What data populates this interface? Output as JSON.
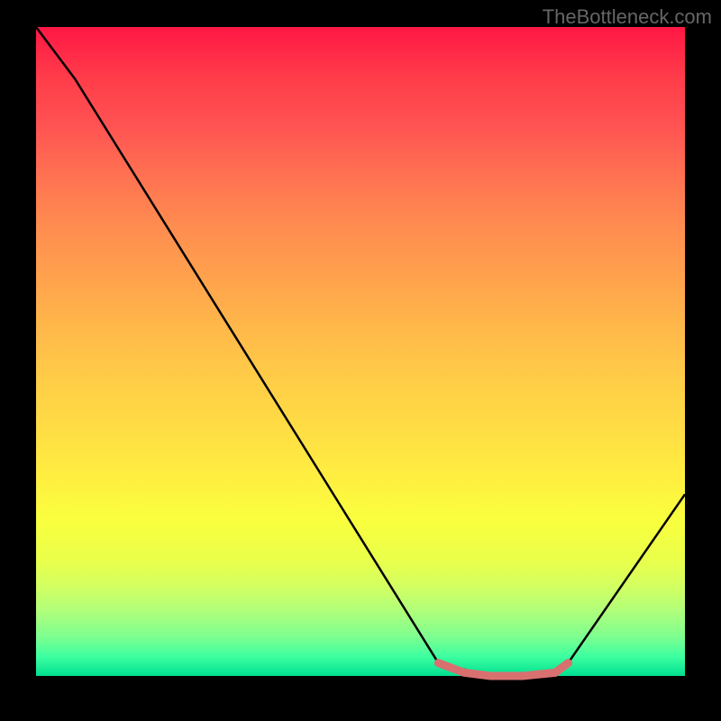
{
  "watermark": "TheBottleneck.com",
  "chart_data": {
    "type": "line",
    "title": "",
    "xlabel": "",
    "ylabel": "",
    "xlim": [
      0,
      100
    ],
    "ylim": [
      0,
      100
    ],
    "grid": false,
    "legend": false,
    "series": [
      {
        "name": "main-curve",
        "x": [
          0,
          6,
          62,
          70,
          80,
          82,
          100
        ],
        "y": [
          100,
          92,
          2,
          0,
          0,
          2,
          28
        ],
        "color": "#000000"
      },
      {
        "name": "highlight-segment",
        "x": [
          62,
          66,
          70,
          75,
          80,
          82
        ],
        "y": [
          2,
          0.5,
          0,
          0,
          0.5,
          2
        ],
        "color": "#d97070"
      }
    ],
    "gradient_background": {
      "top": "#ff1744",
      "bottom": "#00e090"
    }
  }
}
